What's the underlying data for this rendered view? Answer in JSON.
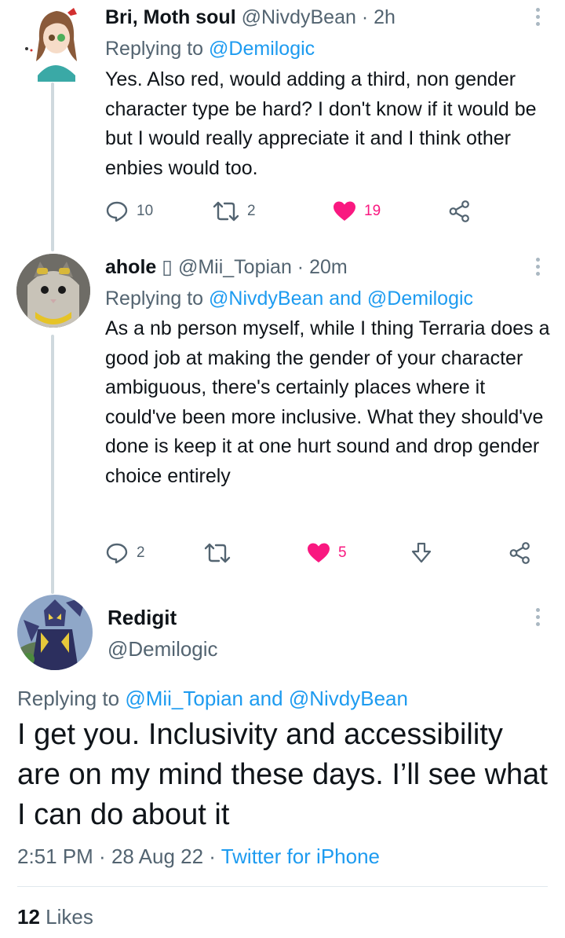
{
  "tweets": [
    {
      "name": "Bri, Moth soul",
      "handle": "@NivdyBean",
      "time": "2h",
      "replying_prefix": "Replying to ",
      "replying_to": "@Demilogic",
      "text": "Yes. Also red, would adding a third, non gender character type be hard? I don't know if it would be but I would really appreciate it and I think other enbies would too.",
      "replies": "10",
      "retweets": "2",
      "likes": "19",
      "avatar_icon": "anime-avatar"
    },
    {
      "name": "ahole",
      "name_glyph": "▯",
      "handle": "@Mii_Topian",
      "time": "20m",
      "replying_prefix": "Replying to ",
      "replying_to": "@NivdyBean and @Demilogic",
      "text": "As a nb person myself, while I thing Terraria does a good job at making the gender of your character ambiguous, there's certainly places where it could've been more inclusive. What they should've done is keep it at one hurt sound and drop gender choice entirely",
      "replies": "2",
      "likes": "5",
      "avatar_icon": "cat-avatar"
    }
  ],
  "main_tweet": {
    "name": "Redigit",
    "handle": "@Demilogic",
    "replying_prefix": "Replying to ",
    "replying_to": "@Mii_Topian and @NivdyBean",
    "text": "I get you. Inclusivity and accessibility are on my mind these days. I’ll see what I can do about it",
    "time": "2:51 PM",
    "date": "28 Aug 22",
    "source": "Twitter for iPhone",
    "likes_count": "12",
    "likes_label": "Likes",
    "avatar_icon": "armored-warrior-avatar"
  },
  "separator": " · ",
  "colors": {
    "link": "#1d9bf0",
    "muted": "#536471",
    "like": "#f91880",
    "thread_line": "#cfd9de"
  }
}
